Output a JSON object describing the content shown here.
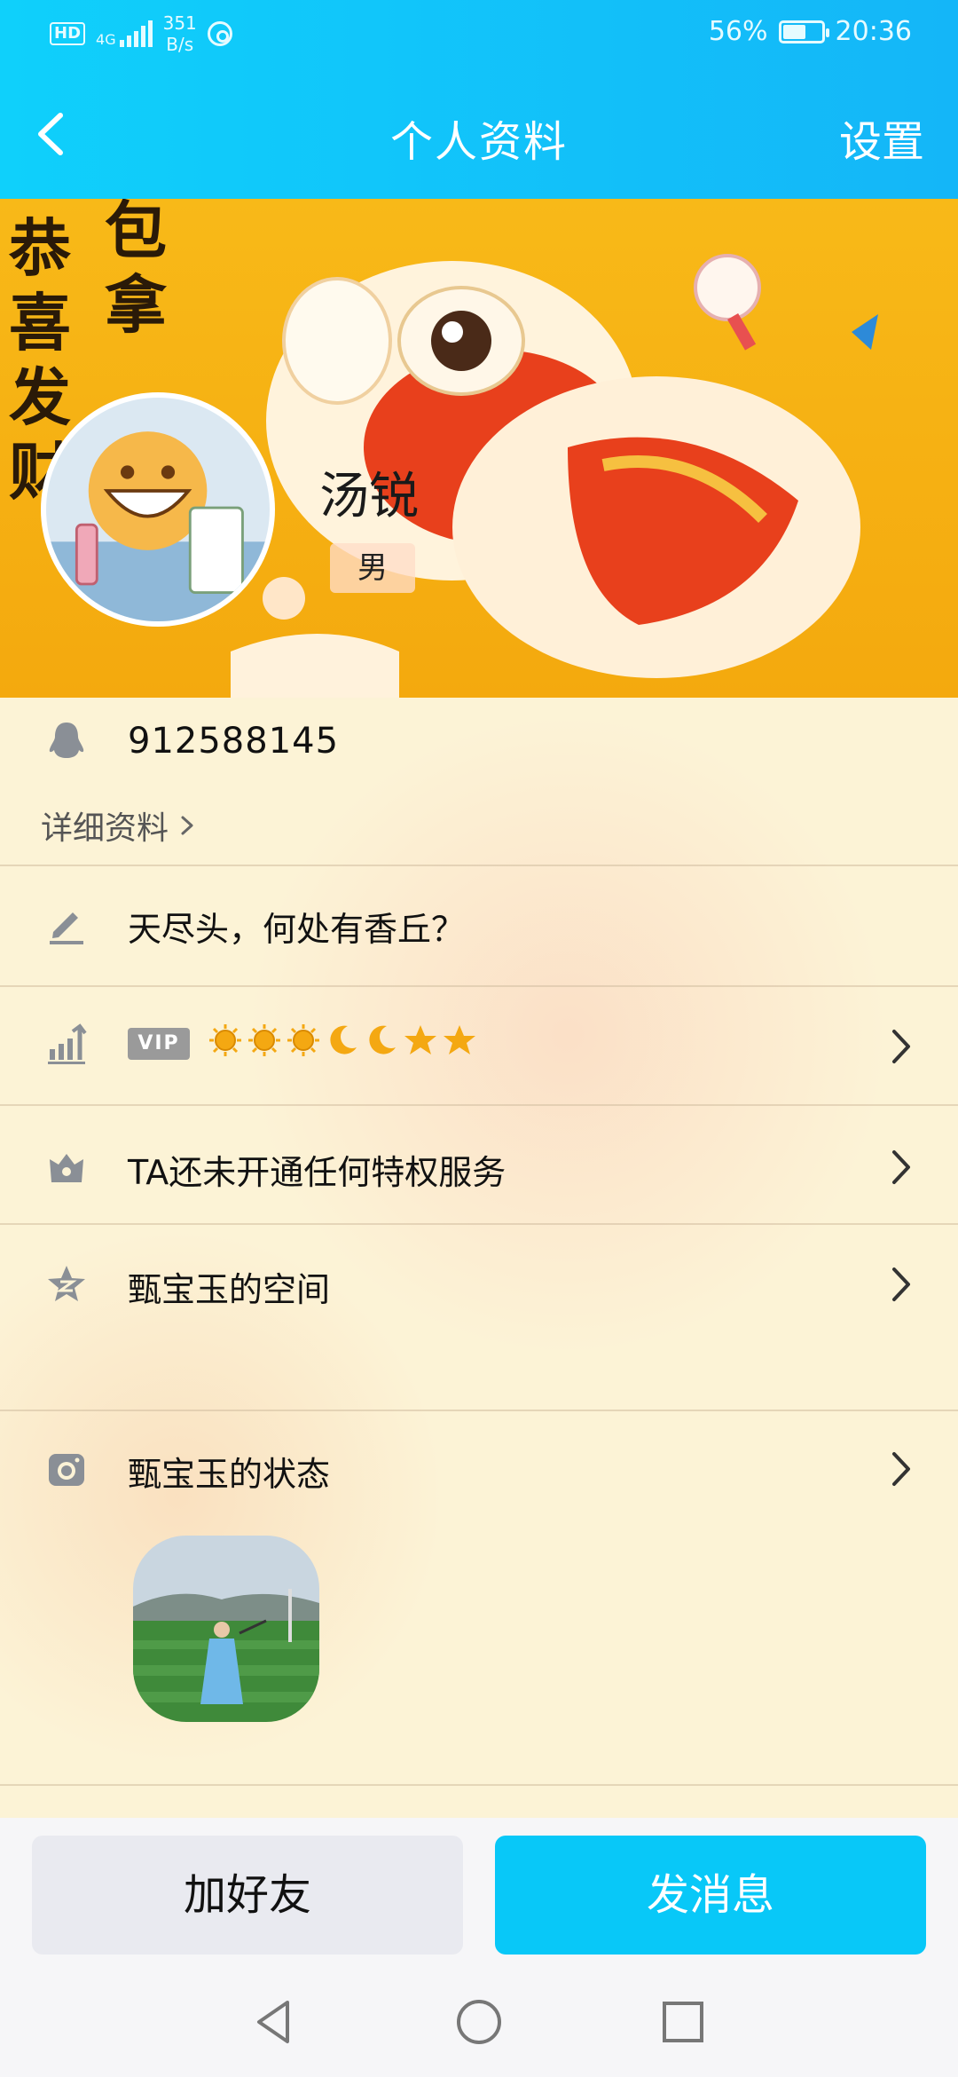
{
  "status_bar": {
    "hd": "HD",
    "network": "4G",
    "speed_value": "351",
    "speed_unit": "B/s",
    "battery": "56%",
    "battery_level": 0.56,
    "time": "20:36"
  },
  "header": {
    "title": "个人资料",
    "settings_label": "设置",
    "back_icon": "back-chevron-icon"
  },
  "cover": {
    "calligraphy_col1": "恭喜发财",
    "calligraphy_col2": "包拿",
    "username": "汤锐",
    "gender": "男"
  },
  "profile": {
    "qq_number": "912588145",
    "detail_link": "详细资料",
    "signature": "天尽头，何处有香丘？",
    "vip_badge": "VIP",
    "vip_levels": [
      "sun",
      "sun",
      "sun",
      "moon",
      "moon",
      "star",
      "star"
    ],
    "privilege_text": "TA还未开通任何特权服务",
    "space_text": "甄宝玉的空间",
    "state_text": "甄宝玉的状态"
  },
  "actions": {
    "add_friend": "加好友",
    "send_message": "发消息"
  },
  "colors": {
    "header_start": "#0fd0fb",
    "header_end": "#14b6f8",
    "primary_button": "#08c8f8",
    "secondary_button": "#e9eaf0",
    "level_icon": "#f4a812"
  }
}
